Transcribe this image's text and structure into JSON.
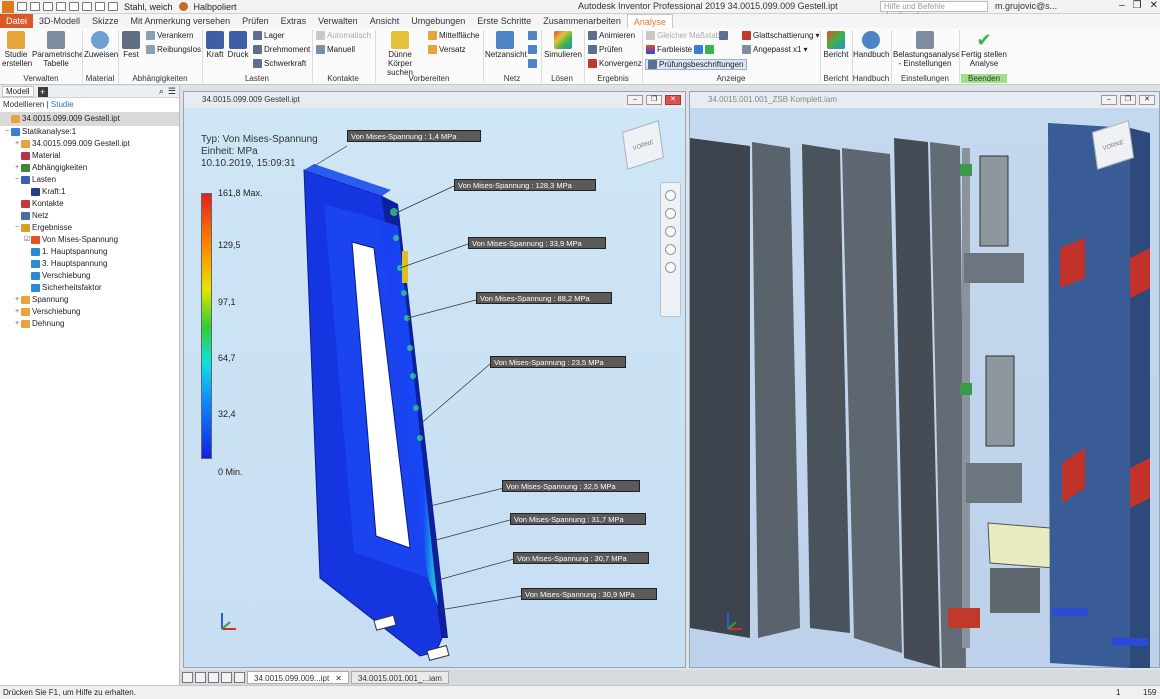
{
  "window": {
    "title": "Autodesk Inventor Professional 2019   34.0015.099.009 Gestell.ipt",
    "material": "Stahl, weich",
    "appearance": "Halbpoliert",
    "search_placeholder": "Hilfe und Befehle durchsuchen",
    "user": "m.grujovic@s..."
  },
  "tabs": [
    "Datei",
    "3D-Modell",
    "Skizze",
    "Mit Anmerkung versehen",
    "Prüfen",
    "Extras",
    "Verwalten",
    "Ansicht",
    "Umgebungen",
    "Erste Schritte",
    "Zusammenarbeiten",
    "Analyse"
  ],
  "ribbon": {
    "verwalten": {
      "label": "Verwalten",
      "studie": "Studie erstellen",
      "tabelle": "Parametrische Tabelle"
    },
    "material": {
      "label": "Material",
      "zuweisen": "Zuweisen"
    },
    "abh": {
      "label": "Abhängigkeiten",
      "fest": "Fest",
      "verankern": "Verankern",
      "reibungslos": "Reibungslos"
    },
    "lasten": {
      "label": "Lasten",
      "kraft": "Kraft",
      "druck": "Druck",
      "lager": "Lager",
      "drehmoment": "Drehmoment",
      "schwerkraft": "Schwerkraft"
    },
    "kontakte": {
      "label": "Kontakte",
      "automatisch": "Automatisch",
      "manuell": "Manuell"
    },
    "vorbereiten": {
      "label": "Vorbereiten",
      "duenne": "Dünne Körper suchen",
      "mittelflaeche": "Mittelfläche",
      "versatz": "Versatz"
    },
    "netz": {
      "label": "Netz",
      "netzansicht": "Netzansicht"
    },
    "loesen": {
      "label": "Lösen",
      "simulieren": "Simulieren"
    },
    "ergebnis": {
      "label": "Ergebnis",
      "animieren": "Animieren",
      "pruefen": "Prüfen",
      "konvergenz": "Konvergenz"
    },
    "anzeige": {
      "label": "Anzeige",
      "massstab": "Gleicher Maßstab",
      "glatt": "Glattschattierung",
      "farbleiste": "Farbleiste",
      "angepasst": "Angepasst x1",
      "beschriftungen": "Prüfungsbeschriftungen"
    },
    "bericht": {
      "label": "Bericht",
      "bericht": "Bericht"
    },
    "handbuch": {
      "label": "Handbuch",
      "handbuch": "Handbuch"
    },
    "einstellungen": {
      "label": "Einstellungen",
      "belastung": "Belastungsanalyse - Einstellungen"
    },
    "beenden": {
      "label": "Beenden",
      "fertig": "Fertig stellen Analyse"
    }
  },
  "browser": {
    "tab": "Modell",
    "modes": [
      "Modellieren",
      "Studie"
    ],
    "tree": [
      {
        "label": "34.0015.099.009 Gestell.ipt",
        "depth": 0,
        "exp": "",
        "color": "#e8a33a",
        "root": true
      },
      {
        "label": "Statikanalyse:1",
        "depth": 0,
        "exp": "−",
        "color": "#3a7dd8"
      },
      {
        "label": "34.0015.099.009 Gestell.ipt",
        "depth": 1,
        "exp": "+",
        "color": "#e8a33a"
      },
      {
        "label": "Material",
        "depth": 1,
        "exp": "",
        "color": "#b5324a"
      },
      {
        "label": "Abhängigkeiten",
        "depth": 1,
        "exp": "+",
        "color": "#3b8a3b"
      },
      {
        "label": "Lasten",
        "depth": 1,
        "exp": "−",
        "color": "#3a5fb0"
      },
      {
        "label": "Kraft:1",
        "depth": 2,
        "exp": "",
        "color": "#2a3a8a"
      },
      {
        "label": "Kontakte",
        "depth": 1,
        "exp": "",
        "color": "#c33a3a"
      },
      {
        "label": "Netz",
        "depth": 1,
        "exp": "",
        "color": "#4a6fa5"
      },
      {
        "label": "Ergebnisse",
        "depth": 1,
        "exp": "−",
        "color": "#d8a020"
      },
      {
        "label": "Von Mises-Spannung",
        "depth": 2,
        "exp": "☑",
        "color": "#e85020"
      },
      {
        "label": "1. Hauptspannung",
        "depth": 2,
        "exp": "",
        "color": "#2a8ad8"
      },
      {
        "label": "3. Hauptspannung",
        "depth": 2,
        "exp": "",
        "color": "#2a8ad8"
      },
      {
        "label": "Verschiebung",
        "depth": 2,
        "exp": "",
        "color": "#2a8ad8"
      },
      {
        "label": "Sicherheitsfaktor",
        "depth": 2,
        "exp": "",
        "color": "#2a8ad8"
      },
      {
        "label": "Spannung",
        "depth": 1,
        "exp": "+",
        "color": "#e8a33a"
      },
      {
        "label": "Verschiebung",
        "depth": 1,
        "exp": "+",
        "color": "#e8a33a"
      },
      {
        "label": "Dehnung",
        "depth": 1,
        "exp": "+",
        "color": "#e8a33a"
      }
    ]
  },
  "viewport1": {
    "title": "34.0015.099.009 Gestell.ipt",
    "type": "Typ: Von Mises-Spannung",
    "unit": "Einheit: MPa",
    "date": "10.10.2019, 15:09:31",
    "legend": [
      "161,8 Max.",
      "129,5",
      "97,1",
      "64,7",
      "32,4",
      "0 Min."
    ],
    "callouts": [
      "Von Mises-Spannung : 1,4 MPa",
      "Von Mises-Spannung : 128,3 MPa",
      "Von Mises-Spannung : 33,9 MPa",
      "Von Mises-Spannung : 88,2 MPa",
      "Von Mises-Spannung : 23,5 MPa",
      "Von Mises-Spannung : 32,5 MPa",
      "Von Mises-Spannung : 31,7 MPa",
      "Von Mises-Spannung : 30,7 MPa",
      "Von Mises-Spannung : 30,9 MPa"
    ]
  },
  "viewport2": {
    "title": "34.0015.001.001_ZSB Komplett.iam"
  },
  "doctabs": [
    "34.0015.099.009...ipt",
    "34.0015.001.001_...iam"
  ],
  "status": {
    "text": "Drücken Sie F1, um Hilfe zu erhalten.",
    "n1": "1",
    "n2": "159"
  }
}
